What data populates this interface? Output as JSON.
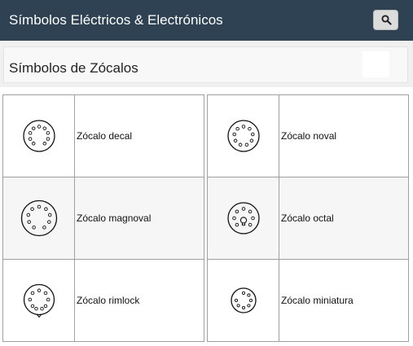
{
  "header": {
    "title": "Símbolos Eléctricos & Electrónicos",
    "search_icon": "search-icon"
  },
  "section": {
    "title": "Símbolos de Zócalos"
  },
  "symbols": [
    {
      "label": "Zócalo decal",
      "icon": "decal-socket-symbol"
    },
    {
      "label": "Zócalo noval",
      "icon": "noval-socket-symbol"
    },
    {
      "label": "Zócalo magnoval",
      "icon": "magnoval-socket-symbol"
    },
    {
      "label": "Zócalo octal",
      "icon": "octal-socket-symbol"
    },
    {
      "label": "Zócalo rimlock",
      "icon": "rimlock-socket-symbol"
    },
    {
      "label": "Zócalo miniatura",
      "icon": "miniature-socket-symbol"
    }
  ],
  "colors": {
    "header_bg": "#2e4253",
    "header_text": "#ffffff",
    "grid_border": "#a0a0a0",
    "alt_row_bg": "#f6f6f6"
  }
}
